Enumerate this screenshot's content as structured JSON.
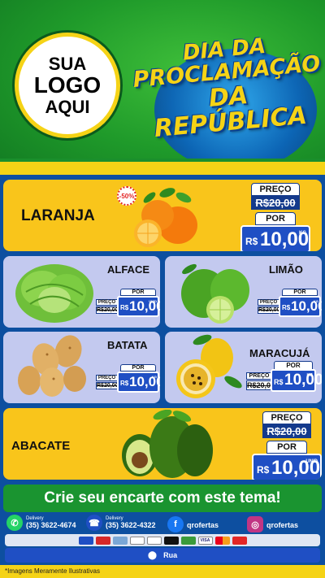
{
  "header": {
    "logo_lines": [
      "SUA",
      "LOGO",
      "AQUI"
    ],
    "title_lines": [
      "DIA DA",
      "PROCLAMAÇÃO",
      "DA REPÚBLICA"
    ]
  },
  "products": [
    {
      "name": "LARANJA",
      "discount_badge": "-50%",
      "price_label": "PREÇO",
      "old_price": "R$20,00",
      "por_label": "POR",
      "currency": "R$",
      "new_price": "10,00",
      "unit": "KG",
      "icon": "orange-fruit-icon"
    },
    {
      "name": "ALFACE",
      "price_label": "PREÇO",
      "old_price": "R$20,00",
      "por_label": "POR",
      "currency": "R$",
      "new_price": "10,00",
      "unit": "UNID",
      "icon": "lettuce-icon"
    },
    {
      "name": "LIMÃO",
      "price_label": "PREÇO",
      "old_price": "R$20,00",
      "por_label": "POR",
      "currency": "R$",
      "new_price": "10,00",
      "unit": "KG",
      "icon": "lime-icon"
    },
    {
      "name": "BATATA",
      "price_label": "PREÇO",
      "old_price": "R$20,00",
      "por_label": "POR",
      "currency": "R$",
      "new_price": "10,00",
      "unit": "KG",
      "icon": "potato-icon"
    },
    {
      "name": "MARACUJÁ",
      "price_label": "PREÇO",
      "old_price": "R$20,00",
      "por_label": "POR",
      "currency": "R$",
      "new_price": "10,00",
      "unit": "KG",
      "icon": "passion-fruit-icon"
    },
    {
      "name": "ABACATE",
      "price_label": "PREÇO",
      "old_price": "R$20,00",
      "por_label": "POR",
      "currency": "R$",
      "new_price": "10,00",
      "unit": "UNID",
      "icon": "avocado-icon"
    }
  ],
  "cta": "Crie seu encarte com este tema!",
  "contact": {
    "whatsapp_label": "Delivery",
    "whatsapp_number": "(35) 3622-4674",
    "phone_label": "Delivery",
    "phone_number": "(35) 3622-4322",
    "facebook": "qrofertas",
    "instagram": "qrofertas"
  },
  "payment_cards": [
    "",
    "",
    "",
    "",
    "",
    "",
    "",
    "VISA",
    "",
    ""
  ],
  "address": "Rua",
  "footer_note": "*Imagens Meramente Ilustrativas",
  "colors": {
    "green": "#1a9430",
    "yellow": "#f9c51b",
    "blue": "#1f4fc4",
    "lavender": "#c3c9ef",
    "navy": "#0d4fa0"
  }
}
